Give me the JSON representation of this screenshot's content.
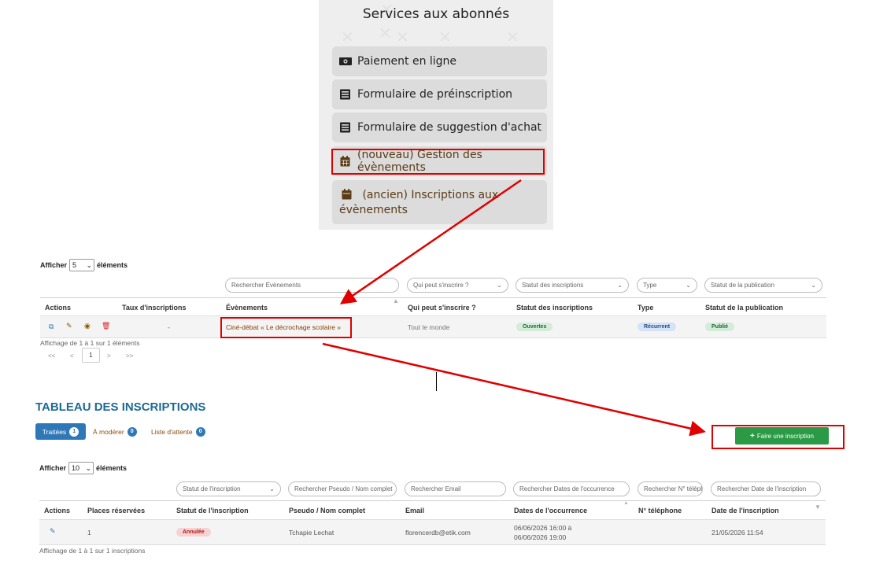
{
  "services": {
    "title": "Services aux abonnés",
    "items": [
      {
        "label": "Paiement en ligne",
        "icon": "money-icon"
      },
      {
        "label": "Formulaire de préinscription",
        "icon": "list-icon"
      },
      {
        "label": "Formulaire de suggestion d'achat",
        "icon": "list-icon"
      },
      {
        "label": "(nouveau) Gestion des évènements",
        "icon": "calendar-icon"
      },
      {
        "label": "(ancien) Inscriptions aux évènements",
        "icon": "calendar-check-icon"
      }
    ]
  },
  "events": {
    "show_label_pre": "Afficher",
    "show_value": "5",
    "show_label_post": "éléments",
    "filters": {
      "search_events": "Rechercher Évènements",
      "who": "Qui peut s'inscrire ?",
      "status": "Statut des inscriptions",
      "type": "Type",
      "publication": "Statut de la publication"
    },
    "headers": [
      "Actions",
      "Taux d'inscriptions",
      "Évènements",
      "Qui peut s'inscrire ?",
      "Statut des inscriptions",
      "Type",
      "Statut de la publication"
    ],
    "row": {
      "rate": "-",
      "event": "Ciné-débat « Le décrochage scolaire »",
      "who": "Tout le monde",
      "status": "Ouvertes",
      "type": "Récurrent",
      "publication": "Publié"
    },
    "info": "Affichage de 1 à 1 sur 1 éléments",
    "pager": {
      "first": "<<",
      "prev": "<",
      "current": "1",
      "next": ">",
      "last": ">>"
    }
  },
  "inscriptions": {
    "title": "TABLEAU DES INSCRIPTIONS",
    "tabs": [
      {
        "label": "Traitées",
        "count": "1"
      },
      {
        "label": "À modérer",
        "count": "0"
      },
      {
        "label": "Liste d'attente",
        "count": "0"
      }
    ],
    "add_button": "Faire une inscription",
    "show_label_pre": "Afficher",
    "show_value": "10",
    "show_label_post": "éléments",
    "filters": {
      "status": "Statut de l'inscription",
      "pseudo": "Rechercher Pseudo / Nom complet",
      "email": "Rechercher Email",
      "dates": "Rechercher Dates de l'occurrence",
      "phone": "Rechercher N° téléphone",
      "date_insc": "Rechercher Date de l'inscription"
    },
    "headers": [
      "Actions",
      "Places réservées",
      "Statut de l'inscription",
      "Pseudo / Nom complet",
      "Email",
      "Dates de l'occurrence",
      "N° téléphone",
      "Date de l'inscription"
    ],
    "row": {
      "places": "1",
      "status": "Annulée",
      "pseudo": "Tchapie Lechat",
      "email": "florencerdb@etik.com",
      "date_line1": "06/06/2026 16:00 à",
      "date_line2": "06/06/2026 19:00",
      "phone": "",
      "date_insc": "21/05/2026 11:54"
    },
    "info": "Affichage de 1 à 1 sur 1 inscriptions"
  },
  "colors": {
    "highlight": "#e00000",
    "primary_blue": "#2f78b7",
    "success_green": "#2a9a46",
    "title_blue": "#1d6a93"
  }
}
